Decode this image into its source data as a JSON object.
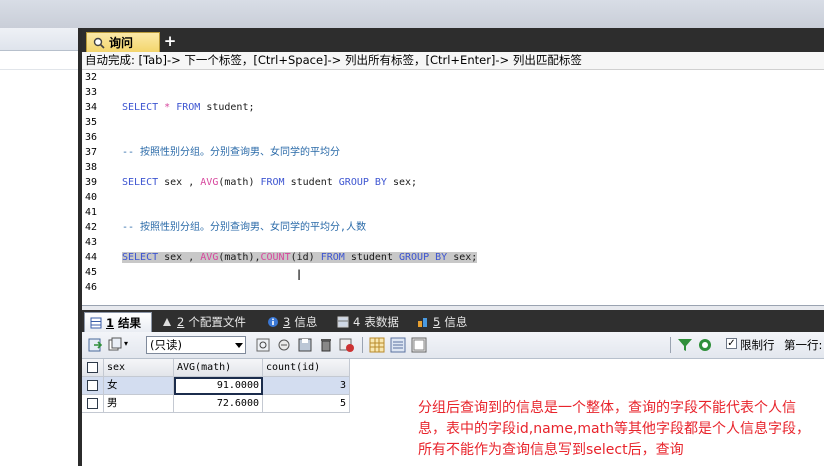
{
  "editor": {
    "tab_label": "询问",
    "add_tab": "+",
    "hint": "自动完成:  [Tab]-> 下一个标签，[Ctrl+Space]-> 列出所有标签，[Ctrl+Enter]-> 列出匹配标签",
    "lines": [
      {
        "num": "32",
        "tokens": []
      },
      {
        "num": "33",
        "tokens": []
      },
      {
        "num": "34",
        "tokens": [
          {
            "t": "SELECT",
            "c": "kw"
          },
          {
            "t": " ",
            "c": "tx"
          },
          {
            "t": "*",
            "c": "fn"
          },
          {
            "t": " ",
            "c": "tx"
          },
          {
            "t": "FROM",
            "c": "kw"
          },
          {
            "t": " student;",
            "c": "tx"
          }
        ]
      },
      {
        "num": "35",
        "tokens": []
      },
      {
        "num": "36",
        "tokens": []
      },
      {
        "num": "37",
        "tokens": [
          {
            "t": "-- 按照性别分组。分别查询男、女同学的平均分",
            "c": "cm"
          }
        ]
      },
      {
        "num": "38",
        "tokens": []
      },
      {
        "num": "39",
        "tokens": [
          {
            "t": "SELECT",
            "c": "kw"
          },
          {
            "t": " sex , ",
            "c": "tx"
          },
          {
            "t": "AVG",
            "c": "fn"
          },
          {
            "t": "(math) ",
            "c": "tx"
          },
          {
            "t": "FROM",
            "c": "kw"
          },
          {
            "t": " student ",
            "c": "tx"
          },
          {
            "t": "GROUP BY",
            "c": "kw"
          },
          {
            "t": " sex;",
            "c": "tx"
          }
        ]
      },
      {
        "num": "40",
        "tokens": []
      },
      {
        "num": "41",
        "tokens": []
      },
      {
        "num": "42",
        "tokens": [
          {
            "t": "-- 按照性别分组。分别查询男、女同学的平均分,人数",
            "c": "cm"
          }
        ]
      },
      {
        "num": "43",
        "tokens": []
      },
      {
        "num": "44",
        "sel": true,
        "tokens": [
          {
            "t": "SELECT",
            "c": "kw"
          },
          {
            "t": " sex , ",
            "c": "tx"
          },
          {
            "t": "AVG",
            "c": "fn"
          },
          {
            "t": "(math),",
            "c": "tx"
          },
          {
            "t": "COUNT",
            "c": "fn"
          },
          {
            "t": "(id) ",
            "c": "tx"
          },
          {
            "t": "FROM",
            "c": "kw"
          },
          {
            "t": " student ",
            "c": "tx"
          },
          {
            "t": "GROUP BY",
            "c": "kw"
          },
          {
            "t": " sex;",
            "c": "tx"
          }
        ]
      },
      {
        "num": "45",
        "tokens": []
      },
      {
        "num": "46",
        "tokens": []
      }
    ]
  },
  "results": {
    "tabs": [
      {
        "num": "1",
        "label": "结果",
        "active": true
      },
      {
        "num": "2",
        "label": "个配置文件",
        "active": false
      },
      {
        "num": "3",
        "label": "信息",
        "active": false
      },
      {
        "num": "4",
        "label": "表数据",
        "active": false
      },
      {
        "num": "5",
        "label": "信息",
        "active": false
      }
    ],
    "toolbar": {
      "mode_select": "(只读)",
      "limit_label": "限制行",
      "limit_checked": true,
      "next_label": "第一行:"
    },
    "grid": {
      "columns": [
        "sex",
        "AVG(math)",
        "count(id)"
      ],
      "rows": [
        {
          "sex": "女",
          "avg": "91.0000",
          "count": "3"
        },
        {
          "sex": "男",
          "avg": "72.6000",
          "count": "5"
        }
      ]
    }
  },
  "annotation": "分组后查询到的信息是一个整体，查询的字段不能代表个人信息，表中的字段id,name,math等其他字段都是个人信息字段，所有不能作为查询信息写到select后，查询",
  "colors": {
    "keyword": "#3d55d1",
    "function": "#d7479d",
    "comment": "#2a6aa8",
    "annotation": "#e8242c"
  }
}
